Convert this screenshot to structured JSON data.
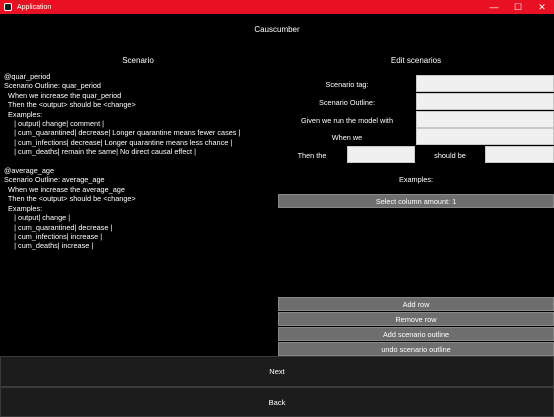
{
  "window": {
    "title": "Application",
    "minimize": "—",
    "maximize": "☐",
    "close": "✕"
  },
  "app": {
    "heading": "Causcumber"
  },
  "scenario_panel": {
    "heading": "Scenario",
    "text": "@quar_period\nScenario Outline: quar_period\n  When we increase the quar_period\n  Then the <output> should be <change>\n  Examples:\n     | output| change| comment |\n     | cum_quarantined| decrease| Longer quarantine means fewer cases |\n     | cum_infections| decrease| Longer quarantine means less chance |\n     | cum_deaths| remain the same| No direct causal effect |\n\n@average_age\nScenario Outline: average_age\n  When we increase the average_age\n  Then the <output> should be <change>\n  Examples:\n     | output| change |\n     | cum_quarantined| decrease |\n     | cum_infections| increase |\n     | cum_deaths| increase |"
  },
  "edit_panel": {
    "heading": "Edit scenarios",
    "scenario_tag_label": "Scenario tag:",
    "scenario_outline_label": "Scenario Outline:",
    "given_label": "Given we run the model with",
    "when_label": "When we",
    "then_label": "Then the",
    "should_be_label": "should be",
    "examples_label": "Examples:",
    "select_column_amount": "Select column amount: 1",
    "fields": {
      "scenario_tag": "",
      "scenario_outline": "",
      "given": "",
      "when": "",
      "then": "",
      "should_be": ""
    }
  },
  "actions": {
    "add_row": "Add row",
    "remove_row": "Remove row",
    "add_scenario_outline": "Add scenario outline",
    "undo_scenario_outline": "undo scenario outline"
  },
  "nav": {
    "next": "Next",
    "back": "Back"
  },
  "colors": {
    "titlebar": "#e81123",
    "background": "#000000",
    "button": "#6e6e6e",
    "field": "#f0f0f0"
  }
}
